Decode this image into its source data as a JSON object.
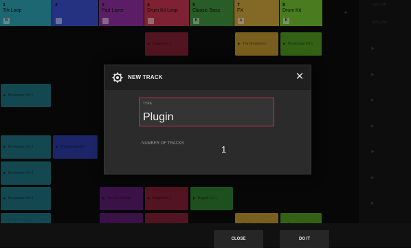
{
  "tracks": [
    {
      "num": "1",
      "name": "Trk Loop",
      "color": "#2d9fb0",
      "box": "B"
    },
    {
      "num": "2",
      "name": "",
      "color": "#3a4ec8",
      "box": ""
    },
    {
      "num": "3",
      "name": "Pad Layer",
      "color": "#8d2f9d",
      "box": ""
    },
    {
      "num": "4",
      "name": "Drum Kit Loop",
      "color": "#c2344e",
      "box": ""
    },
    {
      "num": "5",
      "name": "Classic Bass",
      "color": "#3e8f3e",
      "box": "B"
    },
    {
      "num": "7",
      "name": "FX",
      "color": "#c9a13a",
      "box": "A"
    },
    {
      "num": "8",
      "name": "Drum Kit",
      "color": "#6fbf2f",
      "box": "B"
    }
  ],
  "clips": [
    {
      "col": 3,
      "row": 0,
      "label": "Bugatti FX 1",
      "color": "#7e1f33"
    },
    {
      "col": 5,
      "row": 0,
      "label": "The Breakdown",
      "color": "#b8922d"
    },
    {
      "col": 6,
      "row": 0,
      "label": "Breakdown Kit 1",
      "color": "#4f9722"
    },
    {
      "col": 0,
      "row": 2,
      "label": "Breakdown Kit 1",
      "color": "#1e6f7c"
    },
    {
      "col": 0,
      "row": 4,
      "label": "Breakdown Kit 2",
      "color": "#1e6f7c"
    },
    {
      "col": 1,
      "row": 4,
      "label": "The Breakdown",
      "color": "#2b3aa0"
    },
    {
      "col": 0,
      "row": 5,
      "label": "Breakdown Kit 2",
      "color": "#1e6f7c"
    },
    {
      "col": 0,
      "row": 6,
      "label": "Breakdown Kit 2",
      "color": "#1e6f7c"
    },
    {
      "col": 2,
      "row": 6,
      "label": "The Breakdown",
      "color": "#5a1d6e"
    },
    {
      "col": 3,
      "row": 6,
      "label": "Bugatti FX 1",
      "color": "#7e1f33"
    },
    {
      "col": 4,
      "row": 6,
      "label": "Bugatti FX 1",
      "color": "#2f7a2f"
    },
    {
      "col": 0,
      "row": 7,
      "label": "Breakdown Kit 2",
      "color": "#1e6f7c"
    },
    {
      "col": 2,
      "row": 7,
      "label": "The Breakdown",
      "color": "#5a1d6e"
    },
    {
      "col": 3,
      "row": 7,
      "label": "Bugatti FX 1",
      "color": "#7e1f33"
    },
    {
      "col": 5,
      "row": 7,
      "label": "The Breakdown",
      "color": "#b8922d"
    },
    {
      "col": 6,
      "row": 7,
      "label": "Breakdown Kit 1",
      "color": "#4f9722"
    }
  ],
  "rail": {
    "top_label": "LEN 128",
    "second_label": "FOLLOW"
  },
  "dialog": {
    "title": "NEW TRACK",
    "gear_icon": "gear-icon",
    "close_icon": "close-icon",
    "type_caption": "TYPE",
    "type_value": "Plugin",
    "num_tracks_label": "NUMBER OF TRACKS",
    "num_tracks_value": "1"
  },
  "buttons": {
    "close": "CLOSE",
    "do_it": "DO IT"
  }
}
